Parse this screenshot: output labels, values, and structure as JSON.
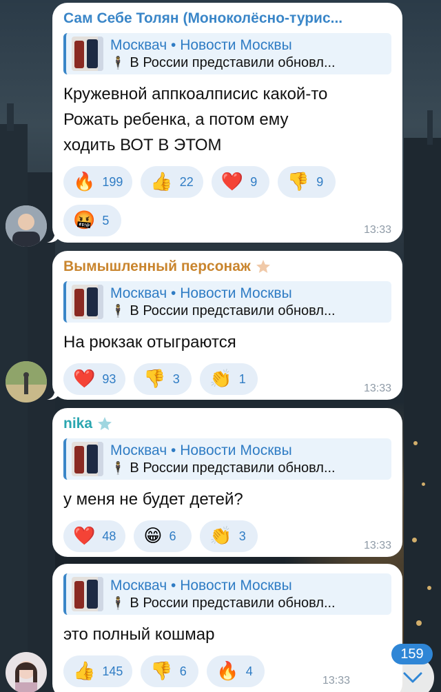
{
  "messages": [
    {
      "sender": "Сам Себе Толян (Моноколёсно-турис...",
      "sender_color": "#3a86c8",
      "reply_title": "Москвач • Новости Москвы",
      "reply_preview": "В России представили обновл...",
      "text": [
        "Кружевной аппкоалписис какой-то",
        "Рожать ребенка, а потом ему",
        "ходить ВОТ В ЭТОМ"
      ],
      "reactions": [
        {
          "emoji": "🔥",
          "icon": "fire-icon",
          "count": "199"
        },
        {
          "emoji": "👍",
          "icon": "thumbs-up-icon",
          "count": "22"
        },
        {
          "emoji": "❤️",
          "icon": "heart-icon",
          "count": "9"
        },
        {
          "emoji": "👎",
          "icon": "thumbs-down-icon",
          "count": "9"
        },
        {
          "emoji": "🤬",
          "icon": "cursing-face-icon",
          "count": "5"
        }
      ],
      "time": "13:33"
    },
    {
      "sender": "Вымышленный персонаж",
      "sender_color": "#c9852e",
      "reply_title": "Москвач • Новости Москвы",
      "reply_preview": "В России представили обновл...",
      "text": [
        "На рюкзак отыграются"
      ],
      "reactions": [
        {
          "emoji": "❤️",
          "icon": "heart-icon",
          "count": "93"
        },
        {
          "emoji": "👎",
          "icon": "thumbs-down-icon",
          "count": "3"
        },
        {
          "emoji": "👏",
          "icon": "clapping-icon",
          "count": "1"
        }
      ],
      "time": "13:33"
    },
    {
      "sender": "nika",
      "sender_color": "#2aa6b0",
      "reply_title": "Москвач • Новости Москвы",
      "reply_preview": "В России представили обновл...",
      "text": [
        "у меня не будет детей?"
      ],
      "reactions": [
        {
          "emoji": "❤️",
          "icon": "heart-icon",
          "count": "48"
        },
        {
          "emoji": "😁",
          "icon": "grin-icon",
          "count": "6"
        },
        {
          "emoji": "👏",
          "icon": "clapping-icon",
          "count": "3"
        }
      ],
      "time": "13:33"
    },
    {
      "sender": "",
      "reply_title": "Москвач • Новости Москвы",
      "reply_preview": "В России представили обновл...",
      "text": [
        "это полный кошмар"
      ],
      "reactions": [
        {
          "emoji": "👍",
          "icon": "thumbs-up-icon",
          "count": "145"
        },
        {
          "emoji": "👎",
          "icon": "thumbs-down-icon",
          "count": "6"
        },
        {
          "emoji": "🔥",
          "icon": "fire-icon",
          "count": "4"
        }
      ],
      "time": "13:33"
    }
  ],
  "unread_badge": "159",
  "colors": {
    "link_blue": "#2f7cc4",
    "bubble_bg": "#ffffff",
    "reaction_bg": "#e5eef8",
    "badge_bg": "#2f86d6"
  }
}
